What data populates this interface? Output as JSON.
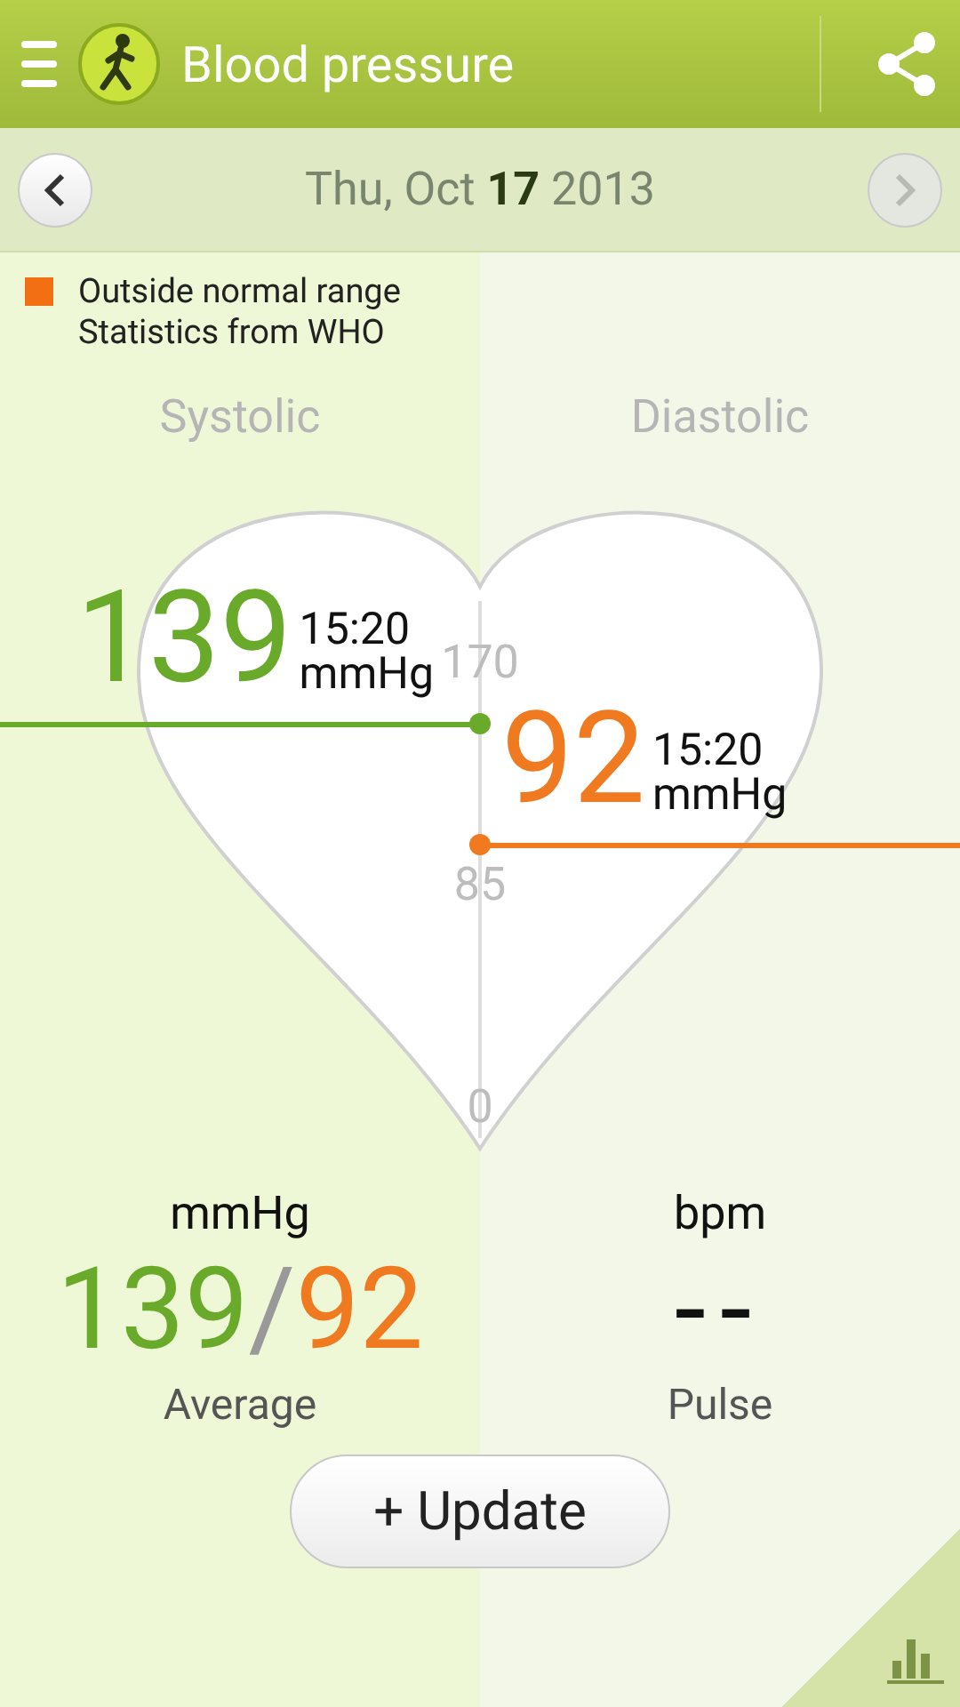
{
  "header": {
    "title": "Blood pressure"
  },
  "date_bar": {
    "date": "Thu, Oct **17** 2013",
    "next_disabled": true
  },
  "legend": [
    {
      "label": "Outside normal range",
      "color": "#f26f13"
    },
    {
      "label": "Statistics from WHO"
    }
  ],
  "columns": [
    "Systolic",
    "Diastolic"
  ],
  "gauge": {
    "ticks": [
      "170",
      "85",
      "0"
    ],
    "readings": [
      {
        "kind": "systolic",
        "value": "139",
        "time": "15:20",
        "unit": "mmHg",
        "color": "#6aaa2a"
      },
      {
        "kind": "diastolic",
        "value": "92",
        "time": "15:20",
        "unit": "mmHg",
        "color": "#f07a20"
      }
    ]
  },
  "summary": {
    "average": {
      "unit": "mmHg",
      "systolic": "139",
      "separator": "/",
      "diastolic": "92",
      "label": "Average"
    },
    "pulse": {
      "unit": "bpm",
      "value": "--",
      "label": "Pulse"
    }
  },
  "update_button": "+ Update"
}
